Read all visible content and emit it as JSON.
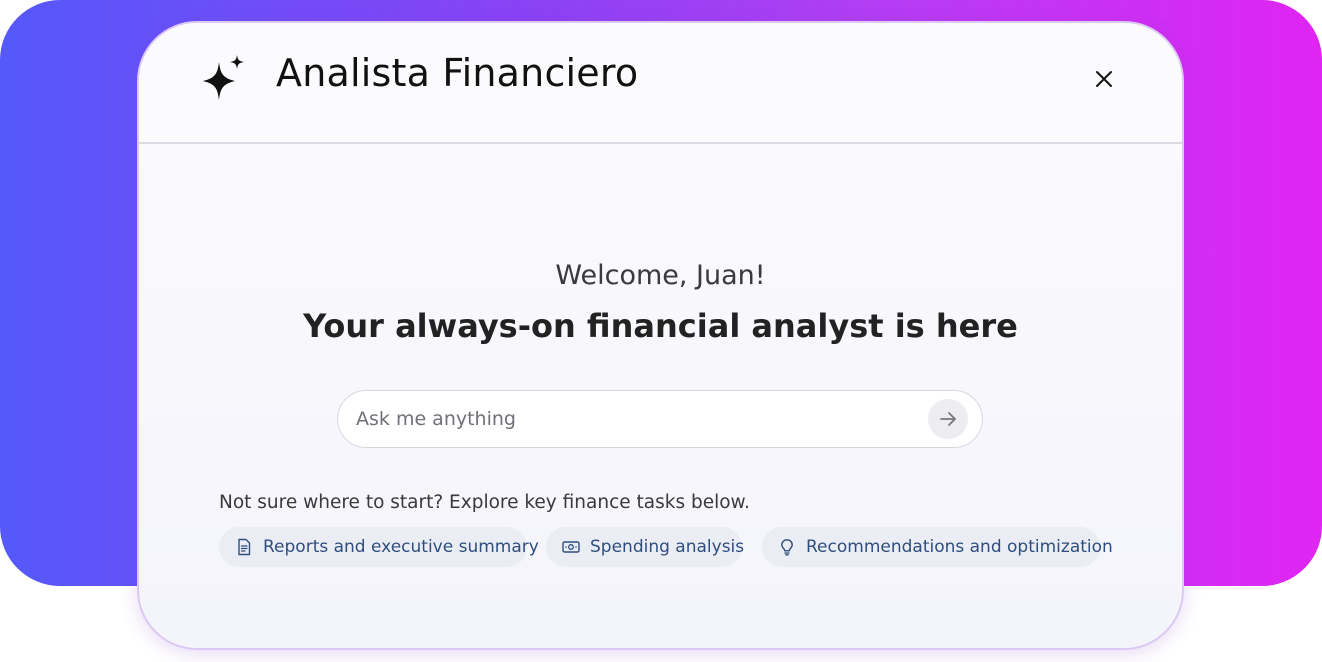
{
  "app": {
    "title": "Analista Financiero",
    "icon": "sparkle-icon",
    "close_icon": "close-icon"
  },
  "welcome": {
    "greeting": "Welcome, Juan!",
    "headline": "Your always-on financial analyst is here"
  },
  "search": {
    "placeholder": "Ask me anything",
    "value": "",
    "send_icon": "arrow-right-icon"
  },
  "suggestions": {
    "hint": "Not sure where to start? Explore key finance tasks below.",
    "chips": [
      {
        "label": "Reports and executive summary",
        "icon": "document-icon"
      },
      {
        "label": "Spending analysis",
        "icon": "banknote-icon"
      },
      {
        "label": "Recommendations and optimization",
        "icon": "lightbulb-icon"
      }
    ]
  },
  "colors": {
    "gradient_start": "#5558fa",
    "gradient_end": "#e025f3",
    "chip_background": "#ebedf4",
    "chip_text": "#2e4e7e"
  }
}
